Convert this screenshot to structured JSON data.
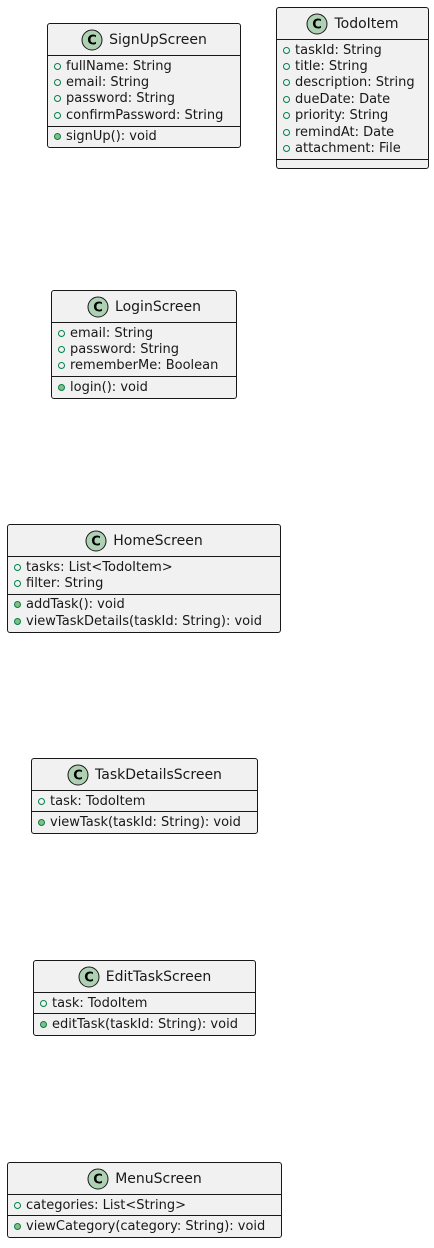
{
  "classes": [
    {
      "id": "signup",
      "name": "SignUpScreen",
      "icon": "class-c-icon",
      "fields": [
        "fullName: String",
        "email: String",
        "password: String",
        "confirmPassword: String"
      ],
      "methods": [
        "signUp(): void"
      ]
    },
    {
      "id": "todo",
      "name": "TodoItem",
      "icon": "class-c-icon",
      "fields": [
        "taskId: String",
        "title: String",
        "description: String",
        "dueDate: Date",
        "priority: String",
        "remindAt: Date",
        "attachment: File"
      ],
      "methods": []
    },
    {
      "id": "login",
      "name": "LoginScreen",
      "icon": "class-c-icon",
      "fields": [
        "email: String",
        "password: String",
        "rememberMe: Boolean"
      ],
      "methods": [
        "login(): void"
      ]
    },
    {
      "id": "home",
      "name": "HomeScreen",
      "icon": "class-c-icon",
      "fields": [
        "tasks: List<TodoItem>",
        "filter: String"
      ],
      "methods": [
        "addTask(): void",
        "viewTaskDetails(taskId: String): void"
      ]
    },
    {
      "id": "details",
      "name": "TaskDetailsScreen",
      "icon": "class-c-icon",
      "fields": [
        "task: TodoItem"
      ],
      "methods": [
        "viewTask(taskId: String): void"
      ]
    },
    {
      "id": "edit",
      "name": "EditTaskScreen",
      "icon": "class-c-icon",
      "fields": [
        "task: TodoItem"
      ],
      "methods": [
        "editTask(taskId: String): void"
      ]
    },
    {
      "id": "menu",
      "name": "MenuScreen",
      "icon": "class-c-icon",
      "fields": [
        "categories: List<String>"
      ],
      "methods": [
        "viewCategory(category: String): void"
      ]
    }
  ],
  "colors": {
    "box_fill": "#f1f1f1",
    "border": "#181818",
    "icon_fill": "#add1b2",
    "visibility_marker": "#038048"
  }
}
